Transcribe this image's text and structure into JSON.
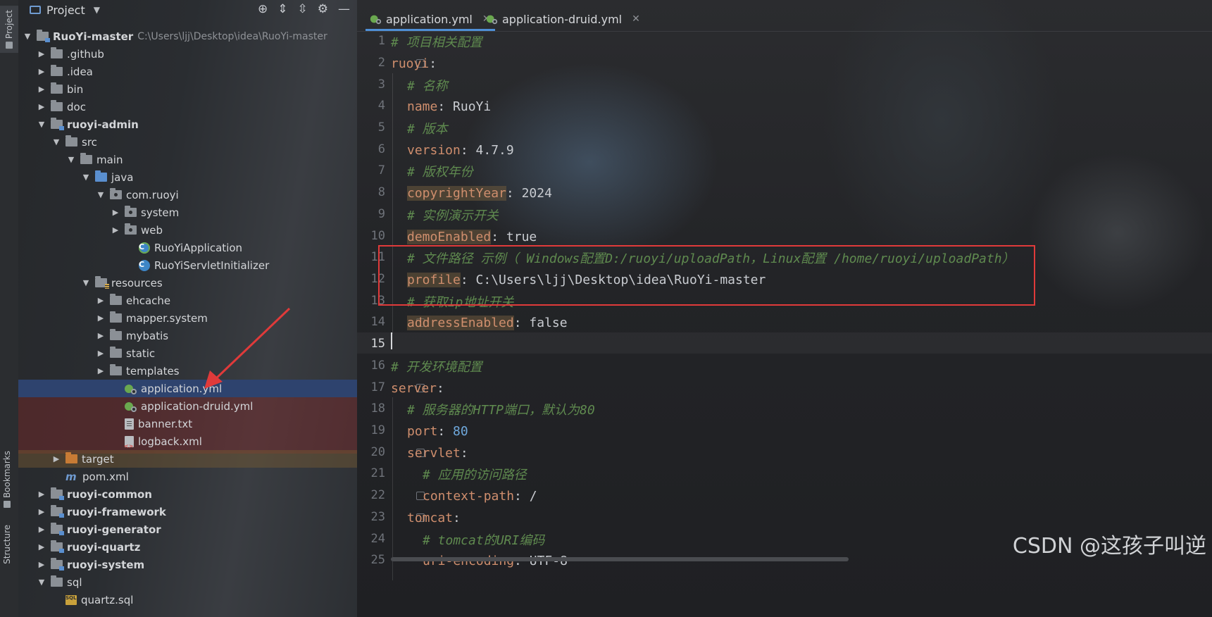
{
  "toolstripe": {
    "project": "Project",
    "bookmarks": "Bookmarks",
    "structure": "Structure"
  },
  "panel": {
    "title": "Project"
  },
  "tree": {
    "root": {
      "name": "RuoYi-master",
      "path": "C:\\Users\\ljj\\Desktop\\idea\\RuoYi-master"
    },
    "github": ".github",
    "idea": ".idea",
    "bin": "bin",
    "doc": "doc",
    "ruoyi_admin": "ruoyi-admin",
    "src": "src",
    "main": "main",
    "java": "java",
    "com_ruoyi": "com.ruoyi",
    "system": "system",
    "web": "web",
    "app_class": "RuoYiApplication",
    "servlet_init": "RuoYiServletInitializer",
    "resources": "resources",
    "ehcache": "ehcache",
    "mapper_system": "mapper.system",
    "mybatis": "mybatis",
    "static": "static",
    "templates": "templates",
    "application_yml": "application.yml",
    "application_druid": "application-druid.yml",
    "banner": "banner.txt",
    "logback": "logback.xml",
    "target": "target",
    "pom": "pom.xml",
    "ruoyi_common": "ruoyi-common",
    "ruoyi_framework": "ruoyi-framework",
    "ruoyi_generator": "ruoyi-generator",
    "ruoyi_quartz": "ruoyi-quartz",
    "ruoyi_system": "ruoyi-system",
    "sql": "sql",
    "quartz_sql": "quartz.sql"
  },
  "tabs": {
    "active": "application.yml",
    "second": "application-druid.yml"
  },
  "lines": [
    "1",
    "2",
    "3",
    "4",
    "5",
    "6",
    "7",
    "8",
    "9",
    "10",
    "11",
    "12",
    "13",
    "14",
    "15",
    "16",
    "17",
    "18",
    "19",
    "20",
    "21",
    "22",
    "23",
    "24",
    "25"
  ],
  "code": {
    "l1": "# 项目相关配置",
    "l2_key": "ruoyi",
    "l3": "# 名称",
    "l4_key": "name",
    "l4_val": "RuoYi",
    "l5": "# 版本",
    "l6_key": "version",
    "l6_val": "4.7.9",
    "l7": "# 版权年份",
    "l8_key": "copyrightYear",
    "l8_val": "2024",
    "l9": "# 实例演示开关",
    "l10_key": "demoEnabled",
    "l10_val": "true",
    "l11": "# 文件路径 示例（ Windows配置D:/ruoyi/uploadPath，Linux配置 /home/ruoyi/uploadPath）",
    "l12_key": "profile",
    "l12_val": "C:\\Users\\ljj\\Desktop\\idea\\RuoYi-master",
    "l13": "# 获取ip地址开关",
    "l14_key": "addressEnabled",
    "l14_val": "false",
    "l16": "# 开发环境配置",
    "l17_key": "server",
    "l18": "# 服务器的HTTP端口，默认为80",
    "l19_key": "port",
    "l19_val": "80",
    "l20_key": "servlet",
    "l21": "# 应用的访问路径",
    "l22_key": "context-path",
    "l22_val": "/",
    "l23_key": "tomcat",
    "l24": "# tomcat的URI编码",
    "l25_key": "uri-encoding",
    "l25_val": "UTF-8"
  },
  "watermark": "CSDN @这孩子叫逆",
  "colors": {
    "highlight_box": "#e03a3a",
    "selected_row": "#2e436e",
    "comment": "#5f8a4f",
    "key": "#cf8e6d"
  }
}
